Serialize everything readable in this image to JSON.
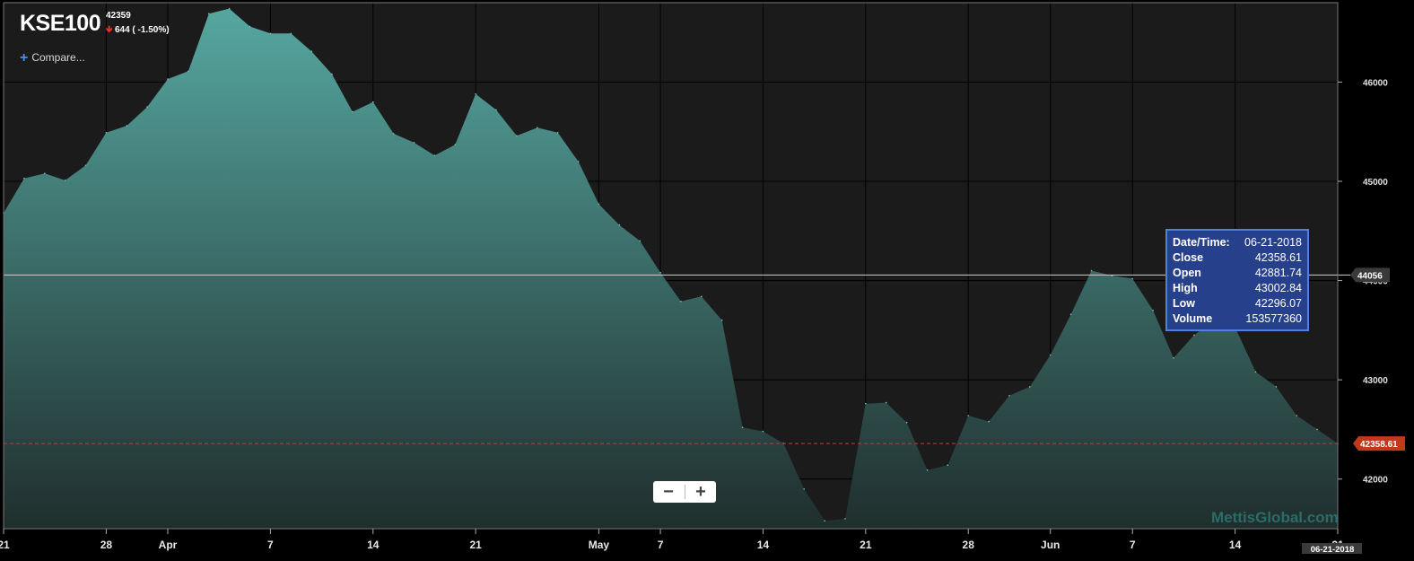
{
  "header": {
    "symbol": "KSE100",
    "last_value": "42359",
    "change_text": "644 ( -1.50%)",
    "change_direction": "down"
  },
  "compare_label": "Compare...",
  "zoom": {
    "minus": "−",
    "plus": "+"
  },
  "tooltip": {
    "rows": [
      {
        "key": "Date/Time:",
        "value": "06-21-2018"
      },
      {
        "key": "Close",
        "value": "42358.61"
      },
      {
        "key": "Open",
        "value": "42881.74"
      },
      {
        "key": "High",
        "value": "43002.84"
      },
      {
        "key": "Low",
        "value": "42296.07"
      },
      {
        "key": "Volume",
        "value": "153577360"
      }
    ]
  },
  "crosshair_label": "44056",
  "current_price_label": "42358.61",
  "date_badge": "06-21-2018",
  "watermark": "MettisGlobal.com",
  "colors": {
    "background": "#1b1b1b",
    "area_top": "#56a7a0",
    "area_bottom": "#1f2e2d",
    "grid": "#000000",
    "price_marker": "#c0391b",
    "crosshair_marker": "#3a3a3a",
    "down_arrow": "#e8322c"
  },
  "chart_data": {
    "type": "area",
    "x": [
      "2018-03-21",
      "2018-03-22",
      "2018-03-23",
      "2018-03-26",
      "2018-03-27",
      "2018-03-28",
      "2018-03-29",
      "2018-03-30",
      "2018-04-02",
      "2018-04-03",
      "2018-04-04",
      "2018-04-05",
      "2018-04-06",
      "2018-04-09",
      "2018-04-10",
      "2018-04-11",
      "2018-04-12",
      "2018-04-13",
      "2018-04-16",
      "2018-04-17",
      "2018-04-18",
      "2018-04-19",
      "2018-04-20",
      "2018-04-23",
      "2018-04-24",
      "2018-04-25",
      "2018-04-26",
      "2018-04-27",
      "2018-04-30",
      "2018-05-02",
      "2018-05-03",
      "2018-05-04",
      "2018-05-07",
      "2018-05-08",
      "2018-05-09",
      "2018-05-10",
      "2018-05-11",
      "2018-05-14",
      "2018-05-15",
      "2018-05-16",
      "2018-05-17",
      "2018-05-18",
      "2018-05-21",
      "2018-05-22",
      "2018-05-23",
      "2018-05-24",
      "2018-05-25",
      "2018-05-28",
      "2018-05-29",
      "2018-05-30",
      "2018-05-31",
      "2018-06-01",
      "2018-06-04",
      "2018-06-05",
      "2018-06-06",
      "2018-06-07",
      "2018-06-08",
      "2018-06-11",
      "2018-06-12",
      "2018-06-13",
      "2018-06-14",
      "2018-06-15",
      "2018-06-18",
      "2018-06-19",
      "2018-06-20",
      "2018-06-21"
    ],
    "y": [
      44680,
      45030,
      45080,
      45010,
      45160,
      45490,
      45560,
      45750,
      46030,
      46110,
      46690,
      46740,
      46560,
      46490,
      46490,
      46310,
      46080,
      45700,
      45800,
      45480,
      45390,
      45260,
      45370,
      45880,
      45720,
      45460,
      45540,
      45490,
      45200,
      44770,
      44560,
      44400,
      44080,
      43790,
      43840,
      43600,
      42520,
      42480,
      42360,
      41900,
      41580,
      41600,
      42760,
      42770,
      42570,
      42090,
      42140,
      42640,
      42580,
      42840,
      42930,
      43250,
      43660,
      44100,
      44050,
      44020,
      43700,
      43220,
      43450,
      43600,
      43530,
      43080,
      42930,
      42640,
      42500,
      42358.61
    ],
    "yticks": [
      42000,
      43000,
      44000,
      45000,
      46000
    ],
    "ylim": [
      41500,
      46800
    ],
    "xtick_labels": [
      {
        "date": "2018-03-21",
        "label": "21"
      },
      {
        "date": "2018-03-28",
        "label": "28"
      },
      {
        "date": "2018-04-02",
        "label": "Apr"
      },
      {
        "date": "2018-04-09",
        "label": "7"
      },
      {
        "date": "2018-04-16",
        "label": "14"
      },
      {
        "date": "2018-04-23",
        "label": "21"
      },
      {
        "date": "2018-05-02",
        "label": "May"
      },
      {
        "date": "2018-05-07",
        "label": "7"
      },
      {
        "date": "2018-05-14",
        "label": "14"
      },
      {
        "date": "2018-05-21",
        "label": "21"
      },
      {
        "date": "2018-05-28",
        "label": "28"
      },
      {
        "date": "2018-06-01",
        "label": "Jun"
      },
      {
        "date": "2018-06-07",
        "label": "7"
      },
      {
        "date": "2018-06-14",
        "label": "14"
      },
      {
        "date": "2018-06-21",
        "label": "21"
      }
    ],
    "crosshair_y": 44056,
    "last_price": 42358.61,
    "grid": true
  }
}
